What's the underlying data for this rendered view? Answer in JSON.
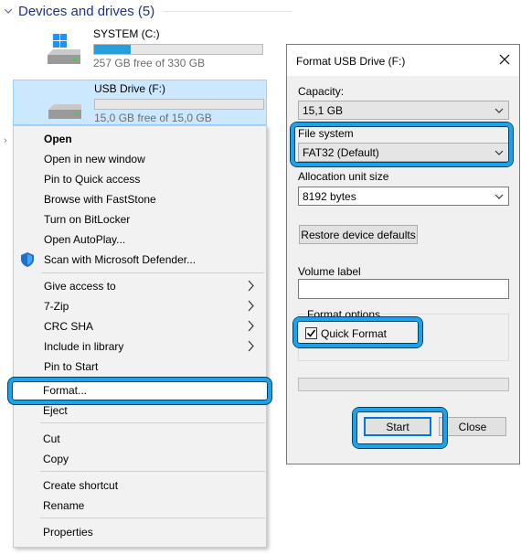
{
  "explorer": {
    "group_title": "Devices and drives (5)",
    "drives": [
      {
        "name": "SYSTEM (C:)",
        "free_text": "257 GB free of 330 GB",
        "used_fraction": 0.22,
        "selected": false
      },
      {
        "name": "USB Drive (F:)",
        "free_text": "15,0 GB free of 15,0 GB",
        "used_fraction": 0.0,
        "selected": true
      }
    ]
  },
  "context_menu": {
    "items": [
      {
        "label": "Open",
        "bold": true
      },
      {
        "label": "Open in new window"
      },
      {
        "label": "Pin to Quick access"
      },
      {
        "label": "Browse with FastStone"
      },
      {
        "label": "Turn on BitLocker"
      },
      {
        "label": "Open AutoPlay..."
      },
      {
        "label": "Scan with Microsoft Defender...",
        "icon": "defender-shield-icon"
      },
      {
        "label": "Give access to",
        "submenu": true
      },
      {
        "label": "7-Zip",
        "submenu": true
      },
      {
        "label": "CRC SHA",
        "submenu": true
      },
      {
        "label": "Include in library",
        "submenu": true
      },
      {
        "label": "Pin to Start"
      },
      {
        "label": "Format..."
      },
      {
        "label": "Eject"
      },
      {
        "label": "Cut"
      },
      {
        "label": "Copy"
      },
      {
        "label": "Create shortcut"
      },
      {
        "label": "Rename"
      },
      {
        "label": "Properties"
      }
    ],
    "highlighted_item": "Format..."
  },
  "format_dialog": {
    "title": "Format USB Drive (F:)",
    "capacity_label": "Capacity:",
    "capacity_value": "15,1 GB",
    "file_system_label": "File system",
    "file_system_value": "FAT32 (Default)",
    "allocation_label": "Allocation unit size",
    "allocation_value": "8192 bytes",
    "restore_defaults_label": "Restore device defaults",
    "volume_label_label": "Volume label",
    "volume_label_value": "",
    "format_options_label": "Format options",
    "quick_format_label": "Quick Format",
    "quick_format_checked": true,
    "progress": 0.0,
    "start_label": "Start",
    "close_label": "Close"
  },
  "colors": {
    "accent_highlight": "#1aa3e8",
    "selection_bg": "#cce8ff",
    "progress_fill": "#26a0da",
    "group_title": "#1e3287"
  }
}
